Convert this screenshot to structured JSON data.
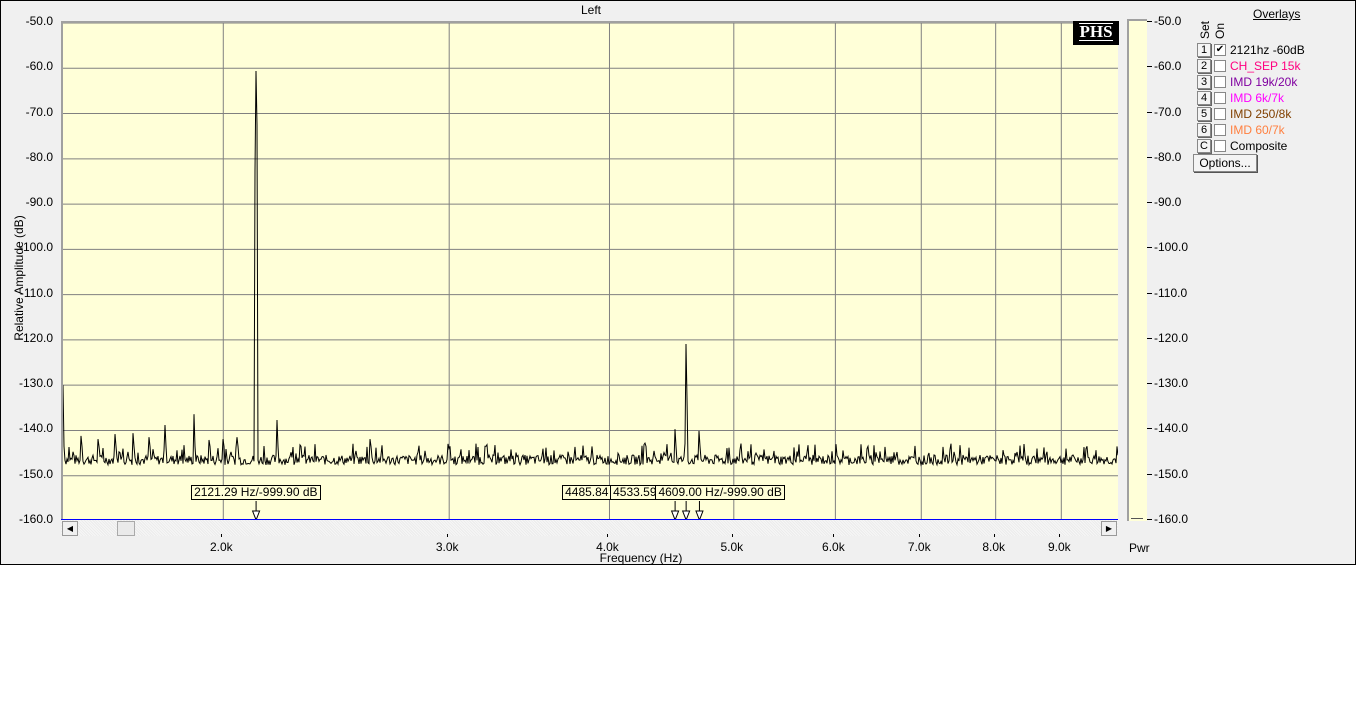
{
  "window": {
    "title": "Left"
  },
  "logo": "PHS",
  "overlays": {
    "title": "Overlays",
    "set_header": "Set",
    "on_header": "On",
    "items": [
      {
        "set": "1",
        "checked": true,
        "label": "2121hz -60dB",
        "color": "#000000"
      },
      {
        "set": "2",
        "checked": false,
        "label": "CH_SEP 15k",
        "color": "#ff0080"
      },
      {
        "set": "3",
        "checked": false,
        "label": "IMD 19k/20k",
        "color": "#8000a0"
      },
      {
        "set": "4",
        "checked": false,
        "label": "IMD 6k/7k",
        "color": "#ff00ff"
      },
      {
        "set": "5",
        "checked": false,
        "label": "IMD 250/8k",
        "color": "#804000"
      },
      {
        "set": "6",
        "checked": false,
        "label": "IMD 60/7k",
        "color": "#ff8040"
      },
      {
        "set": "C",
        "checked": false,
        "label": "Composite",
        "color": "#000000"
      }
    ],
    "options_label": "Options..."
  },
  "power_axis": {
    "label": "Pwr",
    "ticks": [
      "-50.0",
      "-60.0",
      "-70.0",
      "-80.0",
      "-90.0",
      "-100.0",
      "-110.0",
      "-120.0",
      "-130.0",
      "-140.0",
      "-150.0",
      "-160.0"
    ]
  },
  "markers": [
    {
      "freq": 2121.29,
      "label": "2121.29 Hz/-999.90 dB"
    },
    {
      "freq": 4500,
      "label": "4485.84 Hz/-999.90 dB"
    },
    {
      "freq": 4590,
      "label": "4533.59 Hz/-999.90 dB"
    },
    {
      "freq": 4701,
      "label": "4609.00 Hz/-999.90 dB"
    }
  ],
  "chart_data": {
    "type": "line",
    "title": "Left",
    "xlabel": "Frequency (Hz)",
    "ylabel": "Relative Amplitude (dB)",
    "xscale": "log",
    "xlim": [
      1500,
      10000
    ],
    "ylim": [
      -160,
      -50
    ],
    "grid": true,
    "xticks": [
      2000,
      3000,
      4000,
      5000,
      6000,
      7000,
      8000,
      9000
    ],
    "xtick_labels": [
      "2.0k",
      "3.0k",
      "4.0k",
      "5.0k",
      "6.0k",
      "7.0k",
      "8.0k",
      "9.0k"
    ],
    "yticks": [
      -50,
      -60,
      -70,
      -80,
      -90,
      -100,
      -110,
      -120,
      -130,
      -140,
      -150,
      -160
    ],
    "ytick_labels": [
      "-50.0",
      "-60.0",
      "-70.0",
      "-80.0",
      "-90.0",
      "-100.0",
      "-110.0",
      "-120.0",
      "-130.0",
      "-140.0",
      "-150.0",
      "-160.0"
    ],
    "series": [
      {
        "name": "2121hz -60dB",
        "noise_floor_db": -146.5,
        "peaks": [
          [
            1500,
            -130
          ],
          [
            1549,
            -141.2
          ],
          [
            1596,
            -141.9
          ],
          [
            1647,
            -140.8
          ],
          [
            1700,
            -140.6
          ],
          [
            1750,
            -141.5
          ],
          [
            1801,
            -138.8
          ],
          [
            1898,
            -136.4
          ],
          [
            1951,
            -142.1
          ],
          [
            2000,
            -141.9
          ],
          [
            2049,
            -141.5
          ],
          [
            2121,
            -60.6
          ],
          [
            2201,
            -137.7
          ],
          [
            2296,
            -143.2
          ],
          [
            2602,
            -141.9
          ],
          [
            3000,
            -144
          ],
          [
            3200,
            -143.5
          ],
          [
            4262,
            -142.8
          ],
          [
            4496,
            -139.7
          ],
          [
            4590,
            -120.9
          ],
          [
            4701,
            -140.1
          ],
          [
            6349,
            -144
          ],
          [
            9400,
            -144
          ]
        ]
      }
    ]
  }
}
